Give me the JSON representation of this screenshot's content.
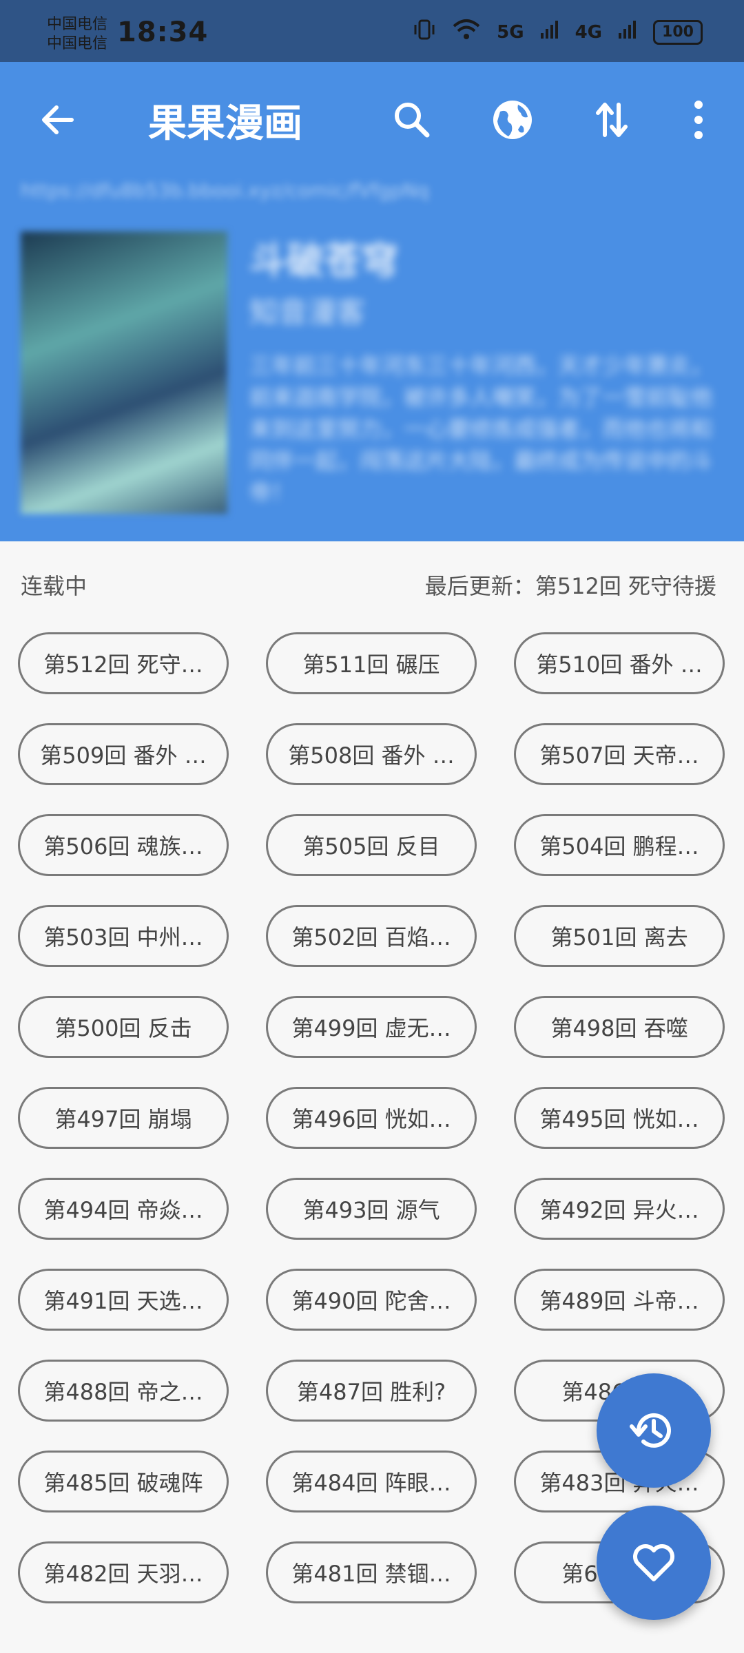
{
  "status_bar": {
    "carrier_1": "中国电信",
    "carrier_2": "中国电信",
    "time": "18:34",
    "signal_1": "5G",
    "signal_2": "4G",
    "battery": "100"
  },
  "app_bar": {
    "title": "果果漫画",
    "icons": [
      "back-arrow-icon",
      "search-icon",
      "globe-icon",
      "swap-icon",
      "more-vert-icon"
    ]
  },
  "comic": {
    "url": "https://dfu8b53b.bbooi.xyz/comic/fVfgpNq",
    "name": "斗破苍穹",
    "author": "知音漫客",
    "description": "三年前三十年河东三十年河西，天才少年萧炎，前来迦南学院，被许多人嘲笑，为了一雪前耻他来到这里努力，一心要修炼成强者，而他也将和同伴一起，闯荡这片大陆，最终成为传说中的斗帝！"
  },
  "status_text": "连载中",
  "last_update": "最后更新：第512回 死守待援",
  "chapters": [
    "第512回 死守…",
    "第511回 碾压",
    "第510回 番外 …",
    "第509回 番外 …",
    "第508回 番外 …",
    "第507回 天帝…",
    "第506回 魂族…",
    "第505回 反目",
    "第504回 鹏程…",
    "第503回 中州…",
    "第502回 百焰…",
    "第501回 离去",
    "第500回 反击",
    "第499回 虚无…",
    "第498回 吞噬",
    "第497回 崩塌",
    "第496回 恍如…",
    "第495回 恍如…",
    "第494回 帝焱…",
    "第493回 源气",
    "第492回 异火…",
    "第491回 天选…",
    "第490回 陀舍…",
    "第489回 斗帝…",
    "第488回 帝之…",
    "第487回 胜利?",
    "第486回 …",
    "第485回 破魂阵",
    "第484回 阵眼…",
    "第483回 异火…",
    "第482回 天羽…",
    "第481回 禁锢…",
    "第626回 …"
  ],
  "fabs": {
    "history": "history-icon",
    "favorite": "heart-icon"
  }
}
